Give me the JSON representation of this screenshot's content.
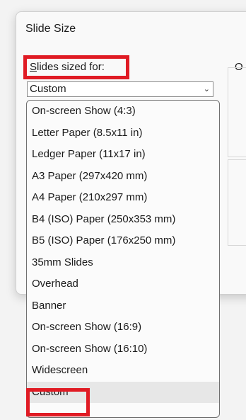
{
  "dialog": {
    "title": "Slide Size",
    "sized_for_label": "Slides sized for:",
    "orientation_label_partial": "O",
    "selected_value": "Custom"
  },
  "dropdown": {
    "options": [
      "On-screen Show (4:3)",
      "Letter Paper (8.5x11 in)",
      "Ledger Paper (11x17 in)",
      "A3 Paper (297x420 mm)",
      "A4 Paper (210x297 mm)",
      "B4 (ISO) Paper (250x353 mm)",
      "B5 (ISO) Paper (176x250 mm)",
      "35mm Slides",
      "Overhead",
      "Banner",
      "On-screen Show (16:9)",
      "On-screen Show (16:10)",
      "Widescreen",
      "Custom"
    ],
    "selected_index": 13
  },
  "icons": {
    "dropdown_arrow": "chevron-down-icon"
  },
  "colors": {
    "highlight": "#e01b24"
  }
}
